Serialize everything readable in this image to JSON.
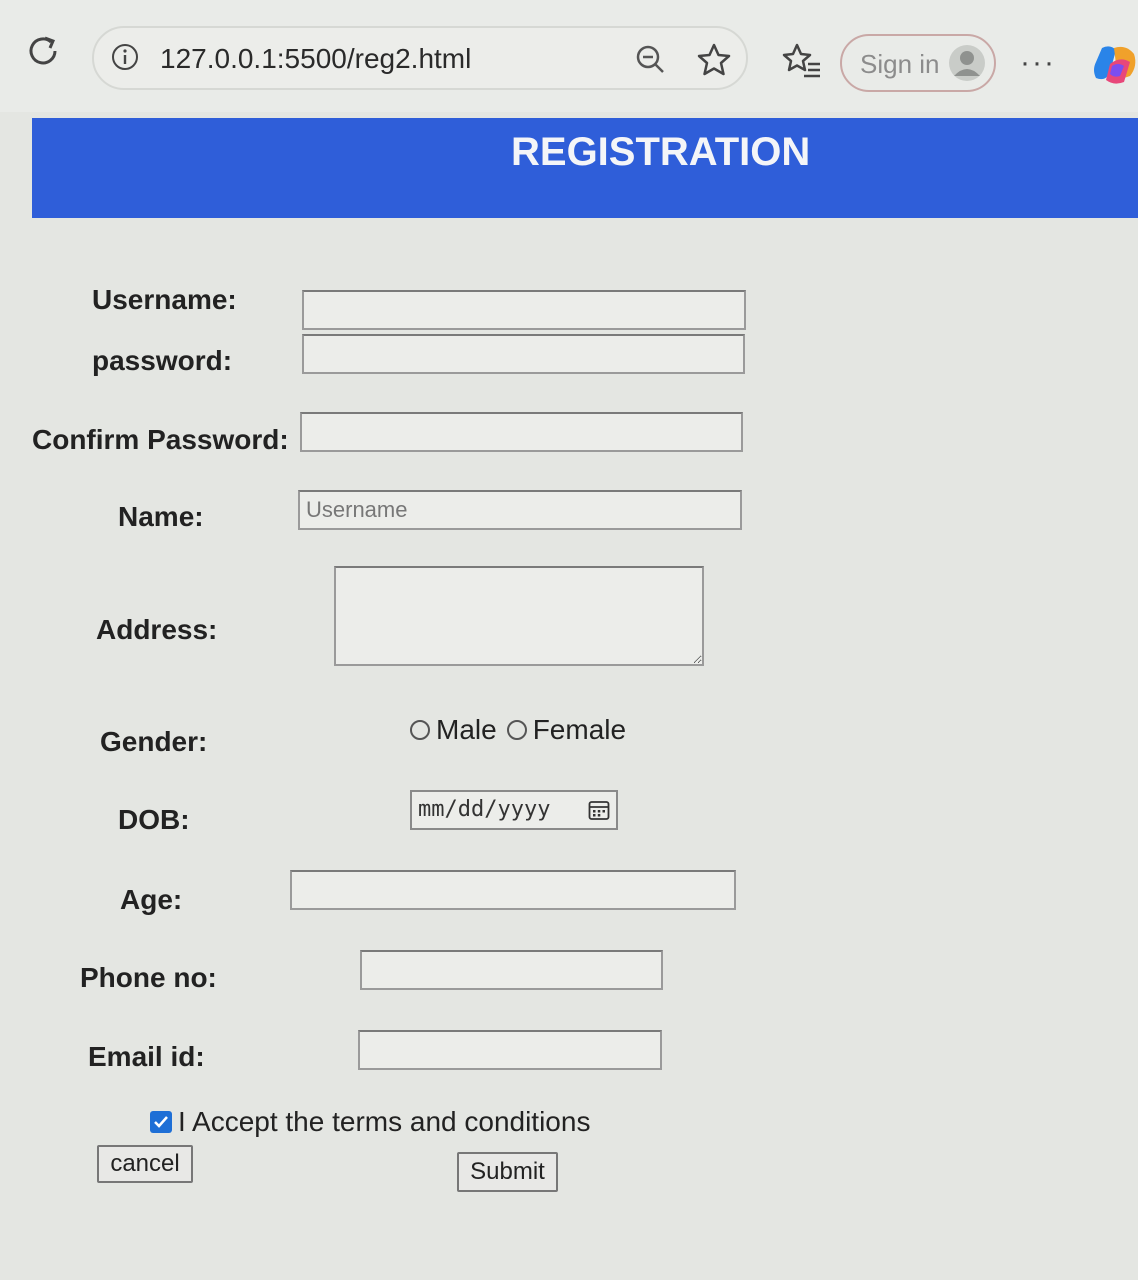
{
  "browser": {
    "url": "127.0.0.1:5500/reg2.html",
    "sign_in": "Sign in",
    "more": "···"
  },
  "header": {
    "title": "REGISTRATION",
    "color": "#2f5ed9"
  },
  "form": {
    "username_label": "Username:",
    "password_label": "password:",
    "confirm_label": "Confirm Password:",
    "name_label": "Name:",
    "name_placeholder": "Username",
    "address_label": "Address:",
    "gender_label": "Gender:",
    "gender_options": [
      "Male",
      "Female"
    ],
    "dob_label": "DOB:",
    "dob_placeholder": "mm/dd/yyyy",
    "age_label": "Age:",
    "phone_label": "Phone no:",
    "email_label": "Email id:",
    "terms_label": "I Accept the terms and conditions",
    "terms_checked": true,
    "cancel_label": "cancel",
    "submit_label": "Submit"
  },
  "icons": [
    "reload-icon",
    "info-icon",
    "zoom-out-icon",
    "star-icon",
    "favorites-icon",
    "avatar-icon",
    "copilot-icon",
    "calendar-icon",
    "checkmark-icon"
  ]
}
